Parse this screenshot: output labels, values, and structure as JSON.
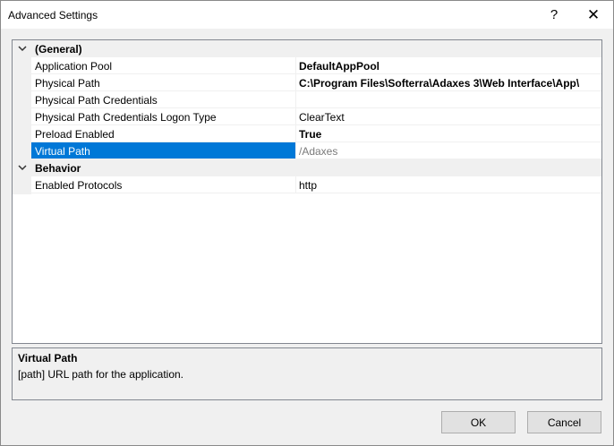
{
  "window": {
    "title": "Advanced Settings",
    "help_glyph": "?",
    "close_glyph": "✕"
  },
  "grid": {
    "categories": [
      {
        "label": "(General)",
        "properties": [
          {
            "name": "Application Pool",
            "value": "DefaultAppPool"
          },
          {
            "name": "Physical Path",
            "value": "C:\\Program Files\\Softerra\\Adaxes 3\\Web Interface\\App\\"
          },
          {
            "name": "Physical Path Credentials",
            "value": ""
          },
          {
            "name": "Physical Path Credentials Logon Type",
            "value": "ClearText"
          },
          {
            "name": "Preload Enabled",
            "value": "True"
          },
          {
            "name": "Virtual Path",
            "value": "/Adaxes"
          }
        ]
      },
      {
        "label": "Behavior",
        "properties": [
          {
            "name": "Enabled Protocols",
            "value": "http"
          }
        ]
      }
    ]
  },
  "help": {
    "title": "Virtual Path",
    "description": "[path] URL path for the application."
  },
  "buttons": {
    "ok": "OK",
    "cancel": "Cancel"
  },
  "colors": {
    "selection": "#0078d7",
    "readonly_text": "#7a7a7a"
  }
}
